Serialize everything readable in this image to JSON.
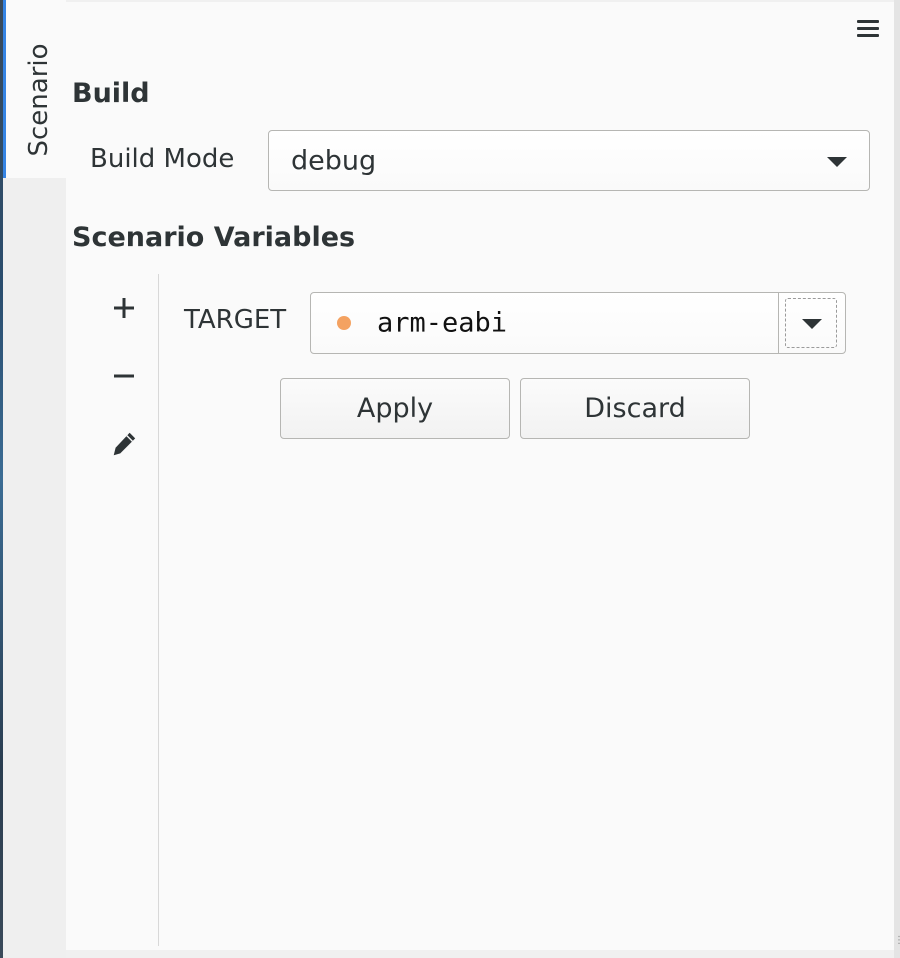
{
  "tab": {
    "label": "Scenario"
  },
  "build": {
    "heading": "Build",
    "mode_label": "Build Mode",
    "mode_value": "debug"
  },
  "variables": {
    "heading": "Scenario Variables",
    "tools": [
      "add-icon",
      "remove-icon",
      "edit-pencil-icon"
    ],
    "target_label": "TARGET",
    "target_value": "arm-eabi",
    "target_marker_color": "#f4a261"
  },
  "actions": {
    "apply_label": "Apply",
    "discard_label": "Discard"
  },
  "colors": {
    "accent": "#3584e4",
    "text": "#2e3436",
    "panel_bg": "#fafafa"
  }
}
